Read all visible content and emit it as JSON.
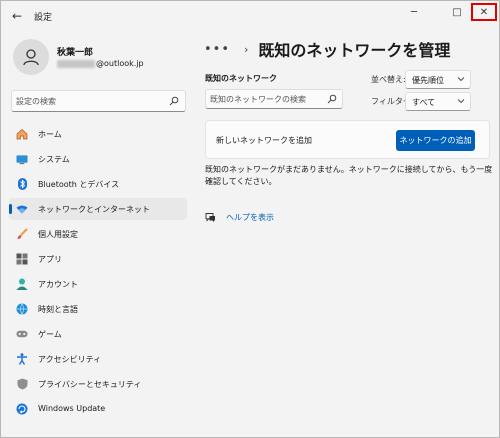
{
  "window": {
    "app_title": "設定",
    "back_glyph": "←",
    "minimize_glyph": "─",
    "maximize_glyph": "□",
    "close_glyph": "✕"
  },
  "user": {
    "name": "秋葉一郎",
    "email_visible": "@outlook.jp"
  },
  "sidebar": {
    "search_placeholder": "設定の検索",
    "items": [
      {
        "label": "ホーム",
        "icon": "home-icon"
      },
      {
        "label": "システム",
        "icon": "system-icon"
      },
      {
        "label": "Bluetooth とデバイス",
        "icon": "bluetooth-icon"
      },
      {
        "label": "ネットワークとインターネット",
        "icon": "wifi-icon",
        "active": true
      },
      {
        "label": "個人用設定",
        "icon": "brush-icon"
      },
      {
        "label": "アプリ",
        "icon": "apps-icon"
      },
      {
        "label": "アカウント",
        "icon": "account-icon"
      },
      {
        "label": "時刻と言語",
        "icon": "globe-clock-icon"
      },
      {
        "label": "ゲーム",
        "icon": "gamepad-icon"
      },
      {
        "label": "アクセシビリティ",
        "icon": "accessibility-icon"
      },
      {
        "label": "プライバシーとセキュリティ",
        "icon": "shield-icon"
      },
      {
        "label": "Windows Update",
        "icon": "update-icon"
      }
    ]
  },
  "main": {
    "breadcrumb_more": "•••",
    "breadcrumb_chevron": "›",
    "page_title": "既知のネットワークを管理",
    "known_networks_label": "既知のネットワーク",
    "known_search_placeholder": "既知のネットワークの検索",
    "sort_label": "並べ替え:",
    "sort_value": "優先順位",
    "filter_label": "フィルター:",
    "filter_value": "すべて",
    "add_card_label": "新しいネットワークを追加",
    "add_button_label": "ネットワークの追加",
    "empty_message": "既知のネットワークがまだありません。ネットワークに接続してから、もう一度確認してください。",
    "help_link": "ヘルプを表示"
  },
  "colors": {
    "accent": "#005fb8",
    "close_highlight": "#e00000",
    "window_bg": "#f3f3f3"
  }
}
